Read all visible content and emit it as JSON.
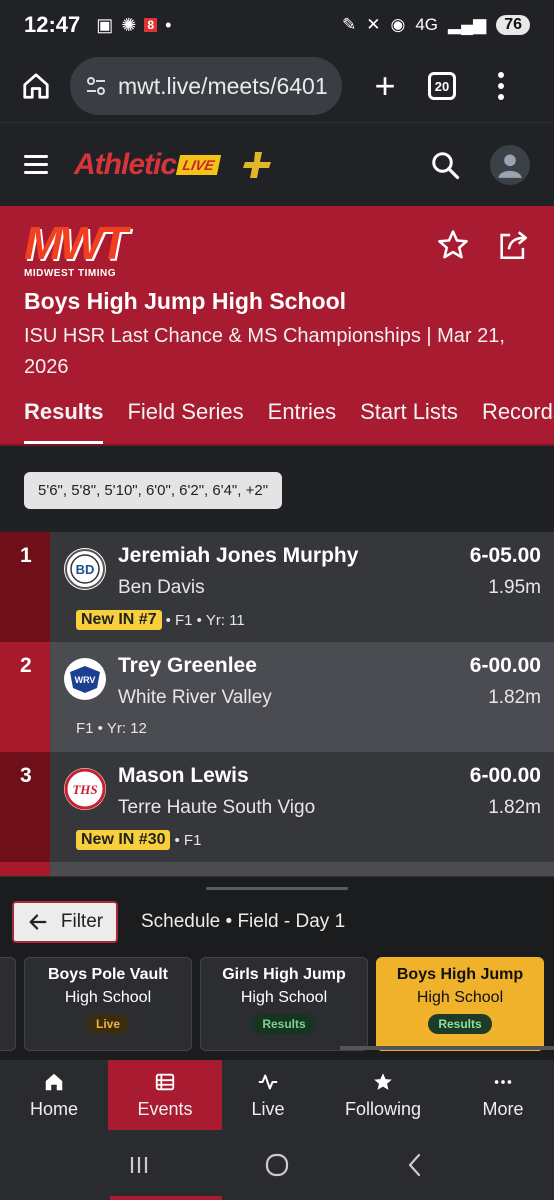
{
  "status_bar": {
    "time": "12:47",
    "network": "4G",
    "battery": "76"
  },
  "browser": {
    "url": "mwt.live/meets/6401",
    "tab_count": "20"
  },
  "app": {
    "brand_text": "Athletic",
    "brand_badge": "LIVE"
  },
  "meet": {
    "timer_logo": "MWT",
    "timer_name": "MIDWEST TIMING",
    "event_title": "Boys High Jump High School",
    "subtitle": "ISU HSR Last Chance & MS Championships | Mar 21, 2026",
    "tabs": [
      "Results",
      "Field Series",
      "Entries",
      "Start Lists",
      "Records"
    ]
  },
  "heights_chip": "5'6\", 5'8\", 5'10\", 6'0\", 6'2\", 6'4\", +2\"",
  "results": [
    {
      "place": "1",
      "athlete": "Jeremiah Jones Murphy",
      "school": "Ben Davis",
      "mark": "6-05.00",
      "metric": "1.95m",
      "badge": "New IN #7",
      "meta": "• F1 • Yr: 11",
      "logo_text": "BD",
      "logo_color": "#1f4f8a"
    },
    {
      "place": "2",
      "athlete": "Trey Greenlee",
      "school": "White River Valley",
      "mark": "6-00.00",
      "metric": "1.82m",
      "badge": "",
      "meta": "F1 • Yr: 12",
      "logo_text": "WRV",
      "logo_color": "#1c3f91"
    },
    {
      "place": "3",
      "athlete": "Mason Lewis",
      "school": "Terre Haute South Vigo",
      "mark": "6-00.00",
      "metric": "1.82m",
      "badge": "New IN #30",
      "meta": "• F1",
      "logo_text": "THS",
      "logo_color": "#c8202f"
    }
  ],
  "sheet": {
    "filter_label": "Filter",
    "schedule_label": "Schedule • Field - Day 1",
    "events": [
      {
        "title": "Boys Pole Vault",
        "sub": "High School",
        "status": "Live",
        "active": false
      },
      {
        "title": "Girls High Jump",
        "sub": "High School",
        "status": "Results",
        "active": false
      },
      {
        "title": "Boys High Jump",
        "sub": "High School",
        "status": "Results",
        "active": true
      }
    ]
  },
  "bottom_nav": [
    {
      "label": "Home",
      "icon": "home-icon"
    },
    {
      "label": "Events",
      "icon": "list-icon",
      "active": true
    },
    {
      "label": "Live",
      "icon": "pulse-icon"
    },
    {
      "label": "Following",
      "icon": "star-icon"
    },
    {
      "label": "More",
      "icon": "more-dots-icon"
    }
  ],
  "colors": {
    "brand_red": "#a91b30",
    "highlight_yellow": "#f1b22b",
    "badge_yellow": "#f7d03c"
  }
}
